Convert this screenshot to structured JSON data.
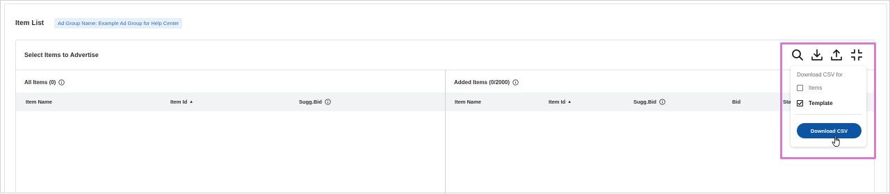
{
  "header": {
    "title": "Item List",
    "badge": "Ad Group Name: Example Ad Group for Help Center"
  },
  "card": {
    "title": "Select Items to Advertise"
  },
  "left_pane": {
    "title": "All Items (0)",
    "columns": [
      {
        "label": "Item Name"
      },
      {
        "label": "Item Id",
        "sort": "▲"
      },
      {
        "label": "Sugg.Bid"
      }
    ]
  },
  "right_pane": {
    "title": "Added Items (0/2000)",
    "columns": [
      {
        "label": "Item Name"
      },
      {
        "label": "Item Id",
        "sort": "▲"
      },
      {
        "label": "Sugg.Bid"
      },
      {
        "label": "Bid"
      },
      {
        "label": "Sta"
      }
    ]
  },
  "toolbar": {
    "icons": [
      "search-icon",
      "download-icon",
      "upload-icon",
      "collapse-icon"
    ]
  },
  "download_menu": {
    "label": "Download CSV for",
    "options": [
      {
        "label": "Items",
        "checked": false
      },
      {
        "label": "Template",
        "checked": true
      }
    ],
    "button_label": "Download CSV"
  },
  "colors": {
    "highlight": "#d97ad1",
    "primary_button": "#0b55a4",
    "badge_bg": "#e6f0fb",
    "header_row_bg": "#f2f3f5"
  }
}
